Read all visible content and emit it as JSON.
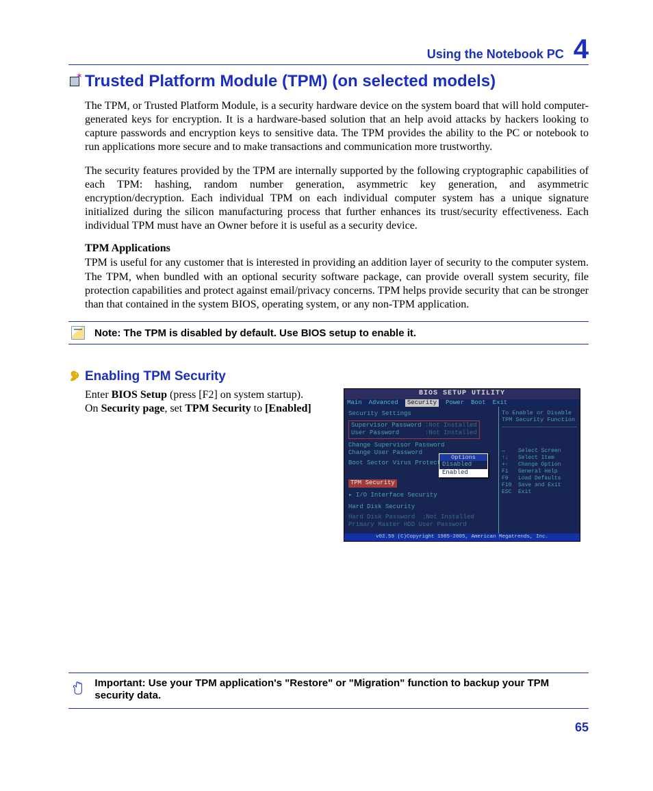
{
  "header": {
    "chapter_title": "Using the Notebook PC",
    "chapter_num": "4"
  },
  "title": "Trusted Platform Module (TPM) (on selected models)",
  "paragraphs": {
    "p1": "The TPM, or Trusted Platform Module, is a security hardware device on the system board that will hold computer-generated keys for encryption. It is a hardware-based solution that an help avoid attacks by hackers looking to capture passwords and encryption keys to sensitive data. The TPM provides the ability to the PC or notebook to run applications more secure and to make transactions and communication more trustworthy.",
    "p2": "The security features provided by the TPM are internally supported by the following cryptographic capabilities of each TPM: hashing, random number generation, asymmetric key generation, and asymmetric encryption/decryption. Each individual TPM on each individual computer system has a unique signature initialized during the silicon manufacturing process that further enhances its trust/security effectiveness. Each individual TPM must have an Owner before it is useful as a security device.",
    "apps_heading": "TPM Applications",
    "p3": "TPM is useful for any customer that is interested in providing an addition layer of security to the computer system. The TPM, when bundled with an optional security software package, can provide overall system security, file protection capabilities and protect against email/privacy concerns. TPM helps provide security that can be stronger than that contained in the system BIOS, operating system, or any non-TPM application."
  },
  "note": "Note: The TPM is disabled by default. Use BIOS setup to enable it.",
  "enabling": {
    "heading": "Enabling TPM Security",
    "line1_a": "Enter ",
    "line1_b": "BIOS Setup",
    "line1_c": " (press [F2] on system startup).",
    "line2_a": "On ",
    "line2_b": "Security page",
    "line2_c": ", set ",
    "line2_d": "TPM Security",
    "line2_e": " to ",
    "line2_f": "[Enabled]"
  },
  "bios": {
    "window_title": "BIOS SETUP UTILITY",
    "tabs": [
      "Main",
      "Advanced",
      "Security",
      "Power",
      "Boot",
      "Exit"
    ],
    "selected_tab": "Security",
    "section": "Security Settings",
    "rows": {
      "supervisor_pw_label": "Supervisor Password",
      "supervisor_pw_value": ":Not Installed",
      "user_pw_label": "User Password",
      "user_pw_value": ":Not Installed",
      "change_super": "Change Supervisor Password",
      "change_user": "Change User Password",
      "boot_sector": "Boot Sector Virus Protection",
      "tpm_security": "TPM Security",
      "io_interface": "▸ I/O Interface Security",
      "hdd_security": "Hard Disk Security",
      "hdd_pw_label": "Hard Disk Password",
      "hdd_pw_value": ":Not Installed",
      "primary_hdd": "Primary Master HDD User Password"
    },
    "options_popup": {
      "title": "Options",
      "opt1": "Disabled",
      "opt2": "Enabled"
    },
    "side": {
      "desc": "To Enable or Disable TPM Security Function",
      "keys": [
        "↔    Select Screen",
        "↑↓   Select Item",
        "+-   Change Option",
        "F1   General Help",
        "F9   Load Defaults",
        "F10  Save and Exit",
        "ESC  Exit"
      ]
    },
    "copyright": "v02.59 (C)Copyright 1985-2005, American Megatrends, Inc."
  },
  "important": "Important: Use your TPM application's \"Restore\" or \"Migration\" function to backup your TPM security data.",
  "page_number": "65"
}
